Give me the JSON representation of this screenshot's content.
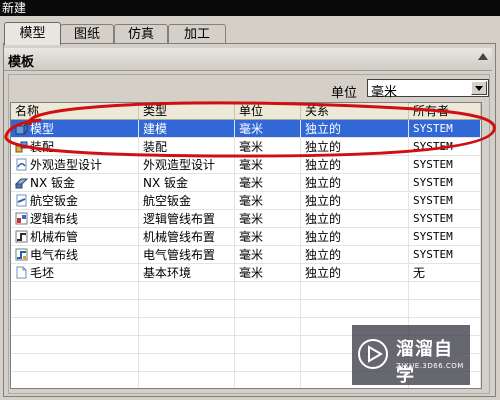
{
  "window": {
    "title": "新建"
  },
  "tabs": [
    {
      "label": "模型",
      "active": true
    },
    {
      "label": "图纸",
      "active": false
    },
    {
      "label": "仿真",
      "active": false
    },
    {
      "label": "加工",
      "active": false
    }
  ],
  "section": {
    "title": "模板"
  },
  "unit": {
    "label": "单位",
    "value": "毫米"
  },
  "table": {
    "columns": [
      "名称",
      "类型",
      "单位",
      "关系",
      "所有者"
    ],
    "rows": [
      {
        "icon": "model-icon",
        "name": "模型",
        "type": "建模",
        "unit": "毫米",
        "relation": "独立的",
        "owner": "SYSTEM",
        "selected": true
      },
      {
        "icon": "assembly-icon",
        "name": "装配",
        "type": "装配",
        "unit": "毫米",
        "relation": "独立的",
        "owner": "SYSTEM"
      },
      {
        "icon": "shape-studio-icon",
        "name": "外观造型设计",
        "type": "外观造型设计",
        "unit": "毫米",
        "relation": "独立的",
        "owner": "SYSTEM"
      },
      {
        "icon": "sheet-metal-icon",
        "name": "NX 钣金",
        "type": "NX 钣金",
        "unit": "毫米",
        "relation": "独立的",
        "owner": "SYSTEM"
      },
      {
        "icon": "aero-sheet-metal-icon",
        "name": "航空钣金",
        "type": "航空钣金",
        "unit": "毫米",
        "relation": "独立的",
        "owner": "SYSTEM"
      },
      {
        "icon": "logical-routing-icon",
        "name": "逻辑布线",
        "type": "逻辑管线布置",
        "unit": "毫米",
        "relation": "独立的",
        "owner": "SYSTEM"
      },
      {
        "icon": "mechanical-routing-icon",
        "name": "机械布管",
        "type": "机械管线布置",
        "unit": "毫米",
        "relation": "独立的",
        "owner": "SYSTEM"
      },
      {
        "icon": "electrical-routing-icon",
        "name": "电气布线",
        "type": "电气管线布置",
        "unit": "毫米",
        "relation": "独立的",
        "owner": "SYSTEM"
      },
      {
        "icon": "blank-icon",
        "name": "毛坯",
        "type": "基本环境",
        "unit": "毫米",
        "relation": "独立的",
        "owner": "无"
      }
    ]
  },
  "watermark": {
    "title": "溜溜自学",
    "subtitle": "ZIXUE.3D66.COM"
  },
  "colors": {
    "selection": "#3168d5",
    "annotation": "#d01010",
    "titlebar": "#0a0a0a"
  }
}
